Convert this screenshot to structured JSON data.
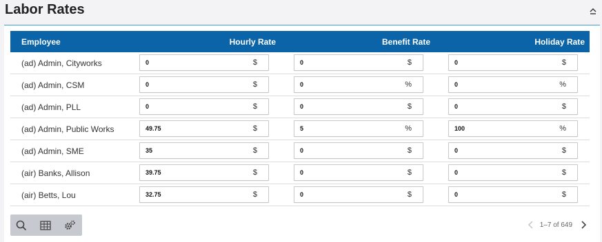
{
  "panel": {
    "title": "Labor Rates"
  },
  "table": {
    "headers": {
      "employee": "Employee",
      "hourly": "Hourly Rate",
      "benefit": "Benefit Rate",
      "holiday": "Holiday Rate"
    },
    "rows": [
      {
        "name": "(ad) Admin, Cityworks",
        "hourly": "0",
        "hourly_unit": "$",
        "benefit": "0",
        "benefit_unit": "$",
        "holiday": "0",
        "holiday_unit": "$"
      },
      {
        "name": "(ad) Admin, CSM",
        "hourly": "0",
        "hourly_unit": "$",
        "benefit": "0",
        "benefit_unit": "%",
        "holiday": "0",
        "holiday_unit": "%"
      },
      {
        "name": "(ad) Admin, PLL",
        "hourly": "0",
        "hourly_unit": "$",
        "benefit": "0",
        "benefit_unit": "$",
        "holiday": "0",
        "holiday_unit": "$"
      },
      {
        "name": "(ad) Admin, Public Works",
        "hourly": "49.75",
        "hourly_unit": "$",
        "benefit": "5",
        "benefit_unit": "%",
        "holiday": "100",
        "holiday_unit": "%"
      },
      {
        "name": "(ad) Admin, SME",
        "hourly": "35",
        "hourly_unit": "$",
        "benefit": "0",
        "benefit_unit": "$",
        "holiday": "0",
        "holiday_unit": "$"
      },
      {
        "name": "(air) Banks, Allison",
        "hourly": "39.75",
        "hourly_unit": "$",
        "benefit": "0",
        "benefit_unit": "$",
        "holiday": "0",
        "holiday_unit": "$"
      },
      {
        "name": "(air) Betts, Lou",
        "hourly": "32.75",
        "hourly_unit": "$",
        "benefit": "0",
        "benefit_unit": "$",
        "holiday": "0",
        "holiday_unit": "$"
      }
    ]
  },
  "toolbar": {
    "icons": [
      "search-icon",
      "table-icon",
      "settings-icon"
    ]
  },
  "pager": {
    "info": "1–7 of 649"
  },
  "colors": {
    "header_bg": "#0b64a8",
    "accent_rule": "#3aa0d4",
    "toolbar_bg": "#c6c9cf"
  }
}
